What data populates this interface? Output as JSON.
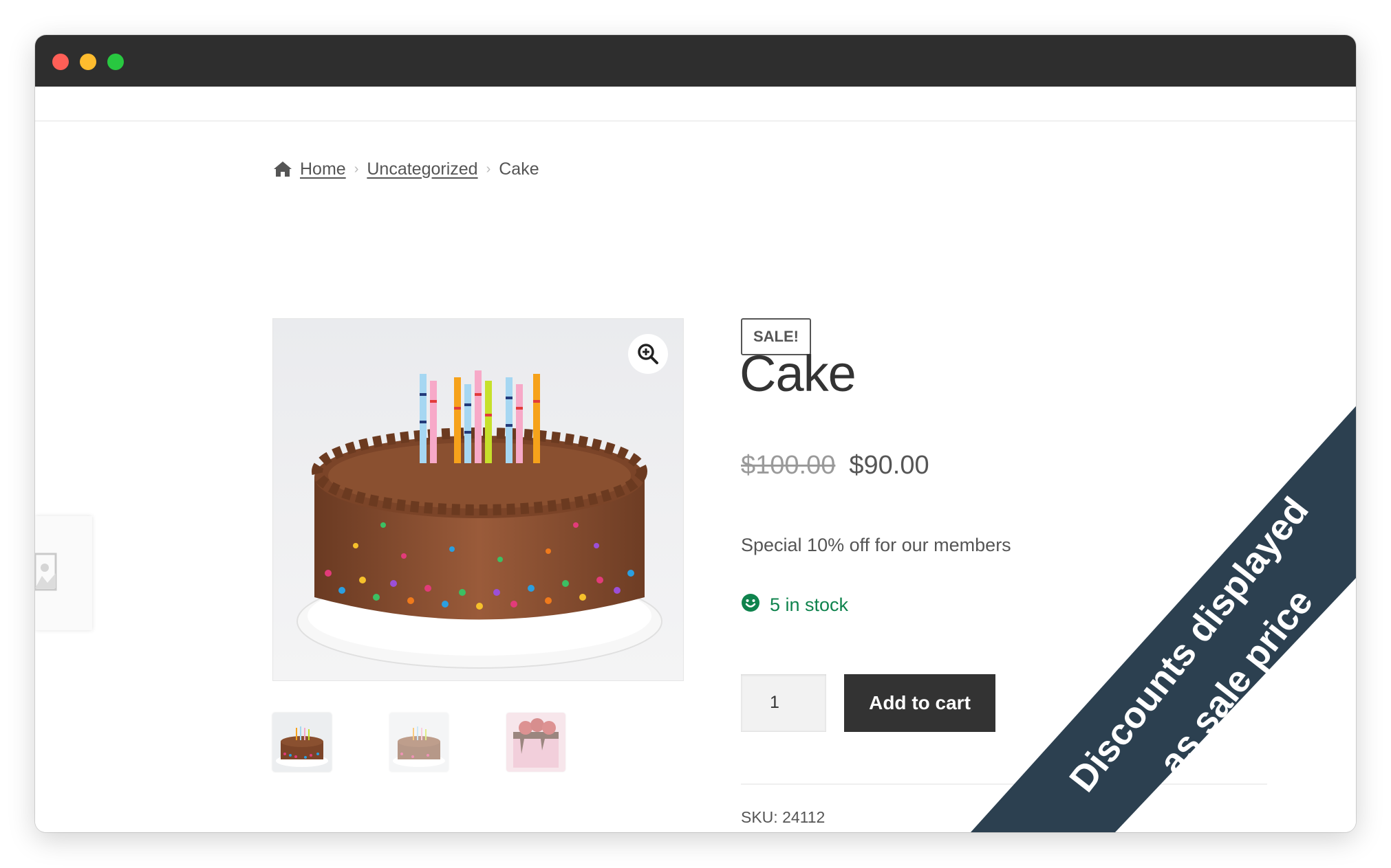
{
  "breadcrumb": {
    "home": "Home",
    "category": "Uncategorized",
    "current": "Cake",
    "separator": "›"
  },
  "product": {
    "badge": "SALE!",
    "title": "Cake",
    "price_old": "$100.00",
    "price_new": "$90.00",
    "short_description": "Special 10% off for our members",
    "stock": "5 in stock",
    "quantity": "1",
    "add_to_cart": "Add to cart",
    "sku_label": "SKU:",
    "sku_value": "24112"
  },
  "ribbon": {
    "line1": "Discounts displayed",
    "line2": "as sale price"
  },
  "colors": {
    "titlebar": "#2e2e2e",
    "stock_green": "#0f834d",
    "button_dark": "#333333",
    "ribbon": "#2c4050"
  },
  "icons": [
    "home-icon",
    "zoom-in-icon",
    "smiley-icon",
    "image-placeholder-icon"
  ]
}
